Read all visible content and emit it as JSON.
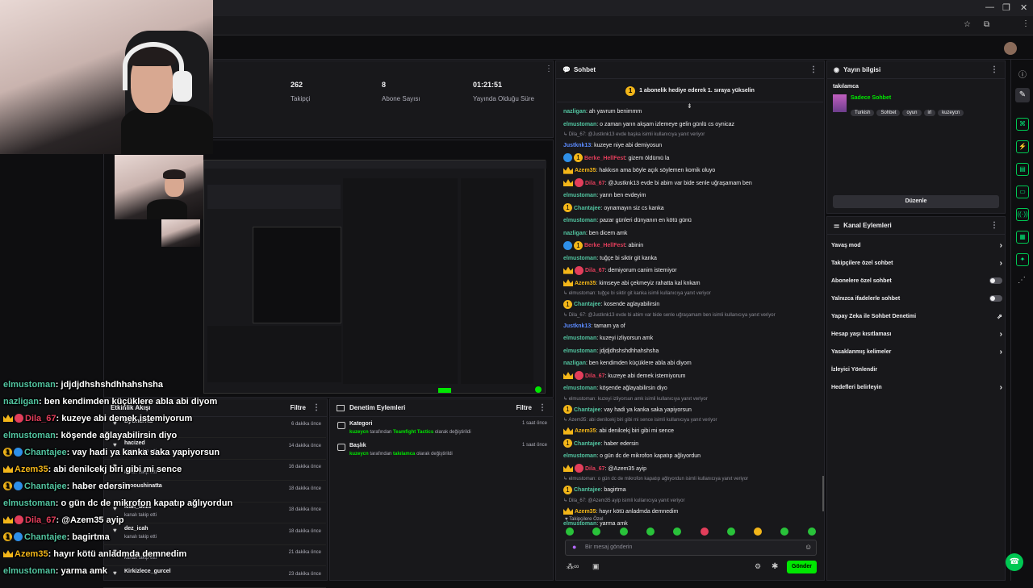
{
  "stats": [
    {
      "value": "262",
      "label": "Takipçi"
    },
    {
      "value": "8",
      "label": "Abone Sayısı"
    },
    {
      "value": "01:21:51",
      "label": "Yayında Olduğu Süre"
    }
  ],
  "chat_panel": {
    "title": "Sohbet",
    "gift_banner": "1 abonelik hediye ederek 1. sıraya yükselin",
    "messages": [
      {
        "type": "msg",
        "user": "nazligan",
        "color": "#52c4a0",
        "text": ": ah yavrum benimmm"
      },
      {
        "type": "msg",
        "user": "elmustoman",
        "color": "#52c4a0",
        "text": ": o zaman yarın akşam izlemeye gelin günlü cs oynicaz"
      },
      {
        "type": "reply",
        "text": "↳ Dila_67: @Justknk13 evde başka isimli kullanıcıya yanıt veriyor"
      },
      {
        "type": "msg",
        "user": "Justknk13",
        "color": "#5b8bff",
        "text": ": kuzeye niye abi demiyosun"
      },
      {
        "type": "msg",
        "badges": "b2 b1",
        "user": "Berke_HellFest",
        "color": "#e33e5b",
        "text": ": gizem öldümü la"
      },
      {
        "type": "msg",
        "badges": "crown",
        "user": "Azem35",
        "color": "#f3b619",
        "text": ": hakkısn ama böyle açık söylemen komik oluyo"
      },
      {
        "type": "msg",
        "badges": "crown b3",
        "user": "Dila_67",
        "color": "#e33e5b",
        "text": ": @Justknk13 evde bi abim var bide senle uğraşamam ben"
      },
      {
        "type": "msg",
        "user": "elmustoman",
        "color": "#52c4a0",
        "text": ": yarın ben evdeyim"
      },
      {
        "type": "msg",
        "badges": "b1",
        "user": "Chantajee",
        "color": "#52c4a0",
        "text": ": oynamayın siz cs kanka"
      },
      {
        "type": "msg",
        "user": "elmustoman",
        "color": "#52c4a0",
        "text": ": pazar günleri dünyanın en kötü günü"
      },
      {
        "type": "msg",
        "user": "nazligan",
        "color": "#52c4a0",
        "text": ": ben dicem amk"
      },
      {
        "type": "msg",
        "badges": "b2 b1",
        "user": "Berke_HellFest",
        "color": "#e33e5b",
        "text": ": abinin"
      },
      {
        "type": "msg",
        "user": "elmustoman",
        "color": "#52c4a0",
        "text": ": tuğçe bi siktir git kanka"
      },
      {
        "type": "msg",
        "badges": "crown b3",
        "user": "Dila_67",
        "color": "#e33e5b",
        "text": ": demiyorum canim istemiyor"
      },
      {
        "type": "msg",
        "badges": "crown",
        "user": "Azem35",
        "color": "#f3b619",
        "text": ": kimseye abi çekmeyiz rahatta kal knkam"
      },
      {
        "type": "reply",
        "text": "↳ elmustoman: tuğçe bi siktir git kanka isimli kullanıcıya yanıt veriyor"
      },
      {
        "type": "msg",
        "badges": "b1",
        "user": "Chantajee",
        "color": "#52c4a0",
        "text": ": kosende aglayabilirsin"
      },
      {
        "type": "reply",
        "text": "↳ Dila_67: @Justknk13 evde bi abim var bide senle uğraşamam ben isimli kullanıcıya yanıt veriyor"
      },
      {
        "type": "msg",
        "user": "Justknk13",
        "color": "#5b8bff",
        "text": ": tamam ya of"
      },
      {
        "type": "msg",
        "user": "elmustoman",
        "color": "#52c4a0",
        "text": ": kuzeyi izliyorsun amk"
      },
      {
        "type": "msg",
        "user": "elmustoman",
        "color": "#52c4a0",
        "text": ": jdjdjdhshshdhhahshsha"
      },
      {
        "type": "msg",
        "user": "nazligan",
        "color": "#52c4a0",
        "text": ": ben kendimden küçüklere abla abi diyom"
      },
      {
        "type": "msg",
        "badges": "crown b3",
        "user": "Dila_67",
        "color": "#e33e5b",
        "text": ": kuzeye abi demek istemiyorum"
      },
      {
        "type": "msg",
        "user": "elmustoman",
        "color": "#52c4a0",
        "text": ": köşende ağlayabilirsin diyo"
      },
      {
        "type": "reply",
        "text": "↳ elmustoman: kuzeyi izliyorsun amk isimli kullanıcıya yanıt veriyor"
      },
      {
        "type": "msg",
        "badges": "b1",
        "user": "Chantajee",
        "color": "#52c4a0",
        "text": ": vay hadi ya kanka saka yapiyorsun"
      },
      {
        "type": "reply",
        "text": "↳ Azem35: abi denilcekj biri gibi mi sence isimli kullanıcıya yanıt veriyor"
      },
      {
        "type": "msg",
        "badges": "crown",
        "user": "Azem35",
        "color": "#f3b619",
        "text": ": abi denilcekj biri gibi mi sence"
      },
      {
        "type": "msg",
        "badges": "b1",
        "user": "Chantajee",
        "color": "#52c4a0",
        "text": ": haber edersin"
      },
      {
        "type": "msg",
        "user": "elmustoman",
        "color": "#52c4a0",
        "text": ": o gün dc de mikrofon kapatıp ağlıyordun"
      },
      {
        "type": "msg",
        "badges": "crown b3",
        "user": "Dila_67",
        "color": "#e33e5b",
        "text": ": @Azem35 ayip"
      },
      {
        "type": "reply",
        "text": "↳ elmustoman: o gün dc de mikrofon kapatıp ağlıyordun isimli kullanıcıya yanıt veriyor"
      },
      {
        "type": "msg",
        "badges": "b1",
        "user": "Chantajee",
        "color": "#52c4a0",
        "text": ": bagirtma"
      },
      {
        "type": "reply",
        "text": "↳ Dila_67: @Azem35 ayip isimli kullanıcıya yanıt veriyor"
      },
      {
        "type": "msg",
        "badges": "crown",
        "user": "Azem35",
        "color": "#f3b619",
        "text": ": hayır kötü anladmda demnedim"
      },
      {
        "type": "msg",
        "user": "elmustoman",
        "color": "#52c4a0",
        "text": ": yarma amk"
      }
    ],
    "followers_only": "Takipçilere Özel",
    "input_placeholder": "Bir mesaj gönderin",
    "send_label": "Gönder"
  },
  "overlay_chat": [
    {
      "user": "elmustoman",
      "color": "#52c4a0",
      "text": ": jdjdjdhshshdhhahshsha"
    },
    {
      "user": "nazligan",
      "color": "#52c4a0",
      "text": ": ben kendimden küçüklere abla abi diyom"
    },
    {
      "user": "Dila_67",
      "badges": "crown b3",
      "color": "#e33e5b",
      "text": ": kuzeye abi demek istemiyorum"
    },
    {
      "user": "elmustoman",
      "color": "#52c4a0",
      "text": ": köşende ağlayabilirsin diyo"
    },
    {
      "user": "Chantajee",
      "badges": "b1 b2",
      "color": "#52c4a0",
      "text": ": vay hadi ya kanka saka yapiyorsun"
    },
    {
      "user": "Azem35",
      "badges": "crown",
      "color": "#f3b619",
      "text": ": abi denilcekj biri gibi mi sence"
    },
    {
      "user": "Chantajee",
      "badges": "b1 b2",
      "color": "#52c4a0",
      "text": ": haber edersin"
    },
    {
      "user": "elmustoman",
      "color": "#52c4a0",
      "text": ": o gün dc de mikrofon kapatıp ağlıyordun"
    },
    {
      "user": "Dila_67",
      "badges": "crown b3",
      "color": "#e33e5b",
      "text": ": @Azem35 ayip"
    },
    {
      "user": "Chantajee",
      "badges": "b1 b2",
      "color": "#52c4a0",
      "text": ": bagirtma"
    },
    {
      "user": "Azem35",
      "badges": "crown",
      "color": "#f3b619",
      "text": ": hayır kötü anladmda demnedim"
    },
    {
      "user": "elmustoman",
      "color": "#52c4a0",
      "text": ": yarma amk"
    }
  ],
  "activity": {
    "title": "Etkinlik Akışı",
    "filter": "Filtre",
    "items": [
      {
        "name": "ByOnurRB",
        "sub": "",
        "time": "6 dakika önce"
      },
      {
        "name": "hacized",
        "sub": "kanalı takip etti",
        "time": "14 dakika önce"
      },
      {
        "name": "",
        "sub": "kanalı takip etti",
        "time": "16 dakika önce"
      },
      {
        "name": "hrooushinatta",
        "sub": "",
        "time": "18 dakika önce"
      },
      {
        "name": "ıcah_dez3",
        "sub": "kanalı takip etti",
        "time": "18 dakika önce"
      },
      {
        "name": "dez_icah",
        "sub": "kanalı takip etti",
        "time": "18 dakika önce"
      },
      {
        "name": "",
        "sub": "kanalı takip etti",
        "time": "21 dakika önce"
      },
      {
        "name": "Kirkizlece_gurcel",
        "sub": "",
        "time": "23 dakika önce"
      }
    ]
  },
  "moderation": {
    "title": "Denetim Eylemleri",
    "filter": "Filtre",
    "items": [
      {
        "title": "Kategori",
        "actor": "kuzeycn",
        "mid": " tarafından ",
        "value": "Teamfight Tactics",
        "rest": " olarak değiştirildi",
        "time": "1 saat önce"
      },
      {
        "title": "Başlık",
        "actor": "kuzeycn",
        "mid": " tarafından ",
        "value": "takılamca",
        "rest": " olarak değiştirildi",
        "time": "1 saat önce"
      }
    ]
  },
  "stream_info": {
    "title": "Yayın bilgisi",
    "stream_title": "takılamca",
    "category": "Sadece Sohbet",
    "tags": [
      "Turkish",
      "Sohbet",
      "oyun",
      "irl",
      "kuzeycn"
    ],
    "edit_label": "Düzenle"
  },
  "channel_actions": {
    "title": "Kanal Eylemleri",
    "items": [
      {
        "label": "Yavaş mod",
        "ctl": "chev"
      },
      {
        "label": "Takipçilere özel sohbet",
        "ctl": "chev"
      },
      {
        "label": "Abonelere özel sohbet",
        "ctl": "tog"
      },
      {
        "label": "Yalnızca ifadelerle sohbet",
        "ctl": "tog"
      },
      {
        "label": "Yapay Zeka ile Sohbet Denetimi",
        "ctl": "ext"
      },
      {
        "label": "Hesap yaşı kısıtlaması",
        "ctl": "chev"
      },
      {
        "label": "Yasaklanmış kelimeler",
        "ctl": "chev"
      },
      {
        "label": "İzleyici Yönlendir",
        "ctl": "none"
      },
      {
        "label": "Hedefleri belirleyin",
        "ctl": "chev"
      }
    ]
  },
  "colors": {
    "accent": "#00e701",
    "bg": "#0e0e10",
    "panel": "#18181b"
  }
}
